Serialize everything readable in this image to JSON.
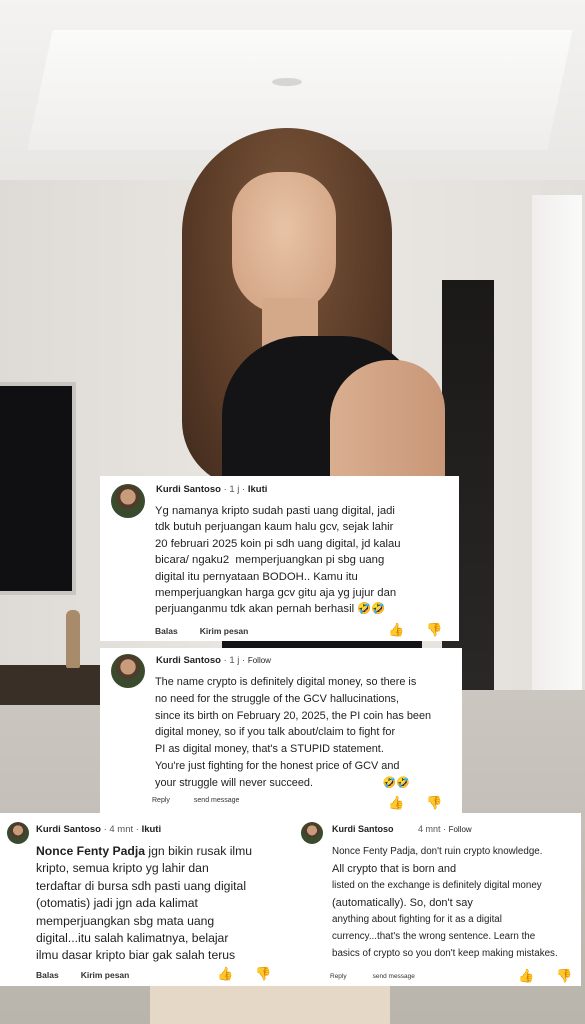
{
  "comments": [
    {
      "author": "Kurdi Santoso",
      "meta": "· 1 j ·",
      "follow": "Ikuti",
      "lines": [
        "Yg namanya kripto sudah pasti uang digital, jadi",
        "tdk butuh perjuangan kaum halu gcv, sejak lahir",
        "20 februari 2025 koin pi sdh uang digital, jd kalau",
        "bicara/ ngaku2  memperjuangkan pi sbg uang",
        "digital itu pernyataan BODOH.. Kamu itu",
        "memperjuangkan harga gcv gitu aja yg jujur dan",
        "perjuanganmu tdk akan pernah berhasil 🤣🤣"
      ],
      "reply": "Balas",
      "send": "Kirim pesan"
    },
    {
      "author": "Kurdi Santoso",
      "meta": "· 1 j ·",
      "follow": "Follow",
      "lines": [
        "The name crypto is definitely digital money, so there is",
        "no need for the struggle of the GCV hallucinations,",
        "since its birth on February 20, 2025, the PI coin has been",
        "digital money, so if you talk about/claim to fight for",
        "PI as digital money, that's a STUPID statement.",
        "You're just fighting for the honest price of GCV and",
        "your struggle will never succeed.                       🤣🤣"
      ],
      "reply": "Reply",
      "send": "send message"
    },
    {
      "author": "Kurdi Santoso",
      "meta": "· 4 mnt ·",
      "follow": "Ikuti",
      "lead": "Nonce Fenty Padja",
      "first_line_rest": " jgn bikin rusak ilmu",
      "lines": [
        "kripto, semua kripto yg lahir dan",
        "terdaftar di bursa sdh pasti uang digital",
        "(otomatis) jadi jgn ada kalimat",
        "memperjuangkan sbg mata uang",
        "digital...itu salah kalimatnya, belajar",
        "ilmu dasar kripto biar gak salah terus"
      ],
      "reply": "Balas",
      "send": "Kirim pesan"
    },
    {
      "author": "Kurdi Santoso",
      "meta": "4 mnt ·",
      "follow": "Follow",
      "lines": [
        "Nonce Fenty Padja, don't ruin crypto knowledge.",
        "All crypto that is born and",
        "listed on the exchange is definitely digital money",
        "(automatically). So, don't say",
        "anything about fighting for it as a digital",
        "currency...that's the wrong sentence. Learn the",
        "basics of crypto so you don't keep making mistakes."
      ],
      "reply": "Reply",
      "send": "send message"
    }
  ]
}
